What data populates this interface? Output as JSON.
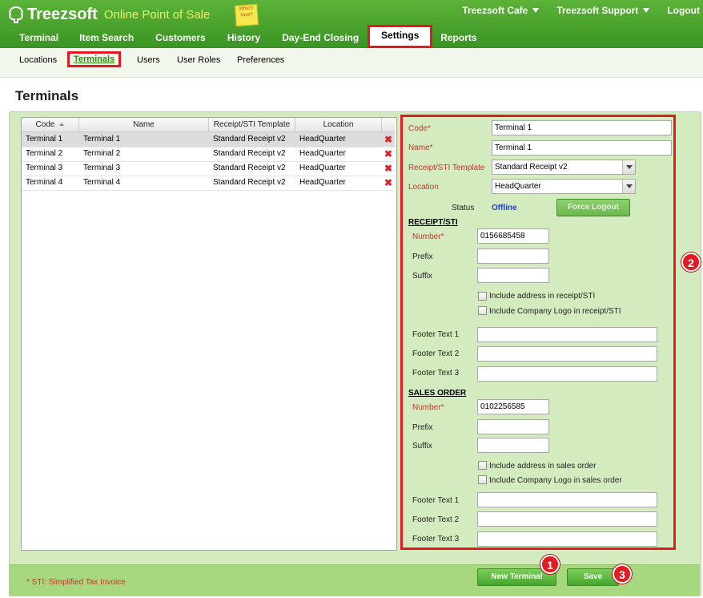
{
  "header": {
    "brand": "Treezsoft",
    "tagline": "Online Point of Sale",
    "whats_new": "What's New?",
    "top_links": [
      "Treezsoft Cafe",
      "Treezsoft Support",
      "Logout"
    ],
    "main_nav": [
      "Terminal",
      "Item Search",
      "Customers",
      "History",
      "Day-End Closing",
      "Settings",
      "Reports"
    ],
    "active_main": "Settings"
  },
  "subnav": {
    "items": [
      "Locations",
      "Terminals",
      "Users",
      "User Roles",
      "Preferences"
    ],
    "active": "Terminals"
  },
  "page": {
    "title": "Terminals"
  },
  "grid": {
    "columns": [
      "Code",
      "Name",
      "Receipt/STI Template",
      "Location"
    ],
    "rows": [
      [
        "Terminal 1",
        "Terminal 1",
        "Standard Receipt v2",
        "HeadQuarter"
      ],
      [
        "Terminal 2",
        "Terminal 2",
        "Standard Receipt v2",
        "HeadQuarter"
      ],
      [
        "Terminal 3",
        "Terminal 3",
        "Standard Receipt v2",
        "HeadQuarter"
      ],
      [
        "Terminal 4",
        "Terminal 4",
        "Standard Receipt v2",
        "HeadQuarter"
      ]
    ],
    "selected_row": 0,
    "delete_glyph": "✖"
  },
  "form": {
    "code_label": "Code*",
    "code_value": "Terminal 1",
    "name_label": "Name*",
    "name_value": "Terminal 1",
    "template_label": "Receipt/STI Template",
    "template_value": "Standard Receipt v2",
    "location_label": "Location",
    "location_value": "HeadQuarter",
    "status_label": "Status",
    "status_value": "Offline",
    "force_logout": "Force Logout",
    "receipt": {
      "title": "RECEIPT/STI",
      "number_label": "Number*",
      "number_value": "0156685458",
      "prefix_label": "Prefix",
      "suffix_label": "Suffix",
      "include_address": "Include address in receipt/STI",
      "include_logo": "Include Company Logo in receipt/STI",
      "footer1": "Footer Text 1",
      "footer2": "Footer Text 2",
      "footer3": "Footer Text 3"
    },
    "sales": {
      "title": "SALES ORDER",
      "number_label": "Number*",
      "number_value": "0102256585",
      "prefix_label": "Prefix",
      "suffix_label": "Suffix",
      "include_address": "Include address in sales order",
      "include_logo": "Include Company Logo in sales order",
      "footer1": "Footer Text 1",
      "footer2": "Footer Text 2",
      "footer3": "Footer Text 3"
    }
  },
  "footer": {
    "sti_note": "* STI: Simplified Tax Invoice",
    "new_terminal": "New Terminal",
    "save": "Save"
  },
  "callouts": [
    "1",
    "2",
    "3"
  ],
  "colors": {
    "header_green": "#3f9a2a",
    "panel_green": "#d3ebbf",
    "highlight_red": "#e21b22",
    "status_blue": "#1a3fd6"
  }
}
